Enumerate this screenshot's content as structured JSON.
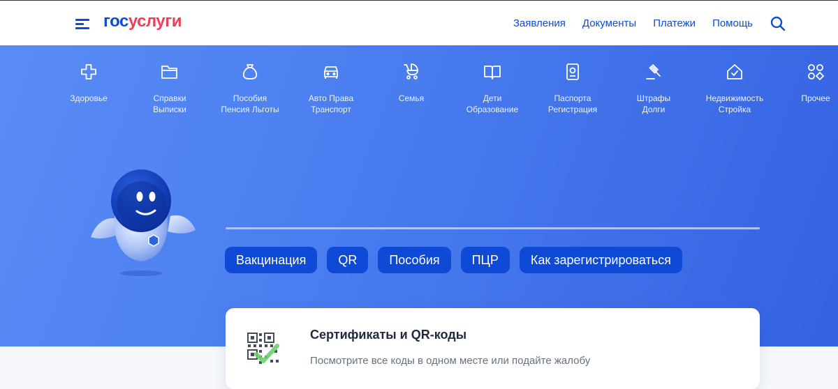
{
  "header": {
    "logo_part1": "гос",
    "logo_part2": "услуги",
    "nav": [
      "Заявления",
      "Документы",
      "Платежи",
      "Помощь"
    ]
  },
  "categories": [
    {
      "icon": "health-cross-icon",
      "line1": "Здоровье",
      "line2": ""
    },
    {
      "icon": "folder-icon",
      "line1": "Справки",
      "line2": "Выписки"
    },
    {
      "icon": "money-bag-icon",
      "line1": "Пособия",
      "line2": "Пенсия Льготы"
    },
    {
      "icon": "car-icon",
      "line1": "Авто Права",
      "line2": "Транспорт"
    },
    {
      "icon": "stroller-icon",
      "line1": "Семья",
      "line2": ""
    },
    {
      "icon": "book-icon",
      "line1": "Дети",
      "line2": "Образование"
    },
    {
      "icon": "passport-icon",
      "line1": "Паспорта",
      "line2": "Регистрация"
    },
    {
      "icon": "gavel-icon",
      "line1": "Штрафы",
      "line2": "Долги"
    },
    {
      "icon": "house-icon",
      "line1": "Недвижимость",
      "line2": "Стройка"
    },
    {
      "icon": "grid-icon",
      "line1": "Прочее",
      "line2": ""
    }
  ],
  "chips": [
    "Вакцинация",
    "QR",
    "Пособия",
    "ПЦР",
    "Как зарегистрироваться"
  ],
  "card": {
    "title": "Сертификаты и QR-коды",
    "subtitle": "Посмотрите все коды в одном месте или подайте жалобу",
    "icon": "qr-code-check-icon"
  },
  "colors": {
    "brand_blue": "#0d4cd3",
    "brand_red": "#ee3f58",
    "chip_bg": "#0e4ad6",
    "hero_start": "#5a8cf5",
    "hero_end": "#3461e2"
  }
}
